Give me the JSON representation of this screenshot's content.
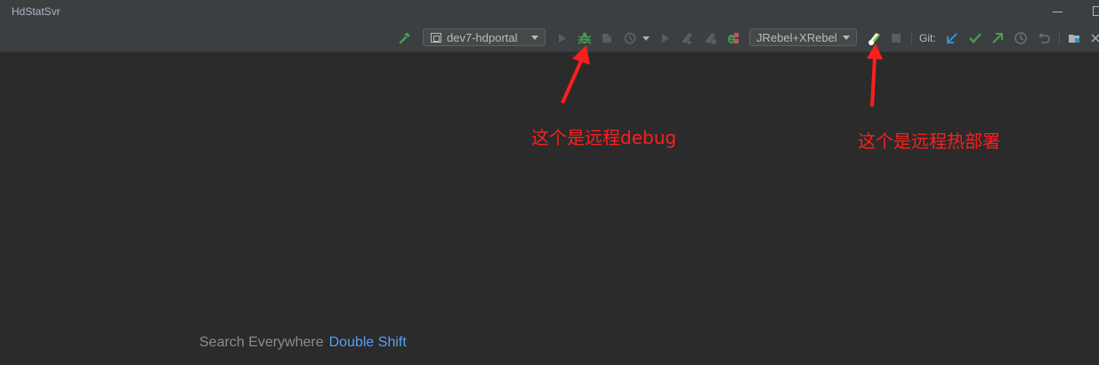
{
  "window": {
    "title": "HdStatSvr"
  },
  "toolbar": {
    "run_config": "dev7-hdportal",
    "jrebel_config": "JRebel+XRebel",
    "git_label": "Git:",
    "icons": [
      "build-icon",
      "run-icon",
      "debug-icon",
      "coverage-icon",
      "profile-icon",
      "dropdown-icon",
      "run-remote-icon",
      "jrebel-run-icon",
      "jrebel-debug-icon",
      "remote-debug-icon",
      "jrebel-deploy-icon",
      "stop-icon",
      "git-update-icon",
      "git-commit-icon",
      "git-push-icon",
      "git-history-icon",
      "git-rollback-icon",
      "project-structure-icon"
    ]
  },
  "annotations": {
    "debug_note": "这个是远程debug",
    "deploy_note": "这个是远程热部署",
    "color": "#ff1e1e"
  },
  "hint": {
    "text": "Search Everywhere",
    "shortcut": "Double Shift"
  },
  "colors": {
    "bg": "#2b2b2b",
    "toolbar": "#3c3f41",
    "accent": "#589df6",
    "green": "#499c54"
  }
}
